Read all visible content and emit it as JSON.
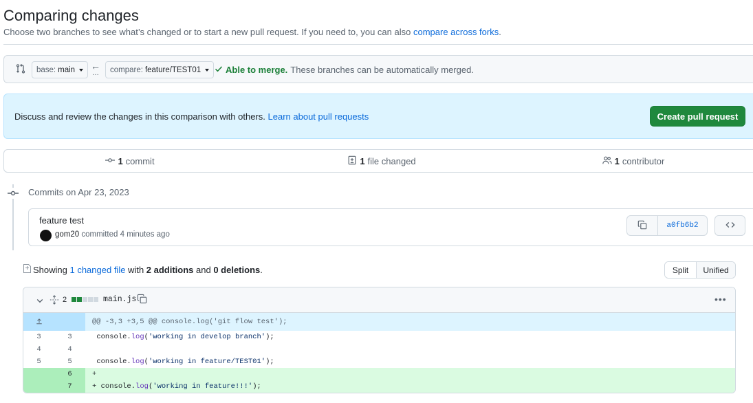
{
  "header": {
    "title": "Comparing changes",
    "subtitle_prefix": "Choose two branches to see what’s changed or to start a new pull request. If you need to, you can also ",
    "subtitle_link": "compare across forks",
    "subtitle_suffix": "."
  },
  "range": {
    "base_prefix": "base:",
    "base_value": "main",
    "compare_prefix": "compare:",
    "compare_value": "feature/TEST01",
    "merge_status": "Able to merge.",
    "merge_message": "These branches can be automatically merged."
  },
  "flash": {
    "text": "Discuss and review the changes in this comparison with others.",
    "link": "Learn about pull requests",
    "button": "Create pull request"
  },
  "summary": {
    "commits_count": "1",
    "commits_label": "commit",
    "files_count": "1",
    "files_label": "file changed",
    "contributors_count": "1",
    "contributors_label": "contributor"
  },
  "commits": {
    "date_heading": "Commits on Apr 23, 2023",
    "items": [
      {
        "title": "feature test",
        "author": "gom20",
        "meta": "committed 4 minutes ago",
        "sha": "a0fb6b2"
      }
    ]
  },
  "toc": {
    "prefix": "Showing ",
    "files_link": "1 changed file",
    "mid1": " with ",
    "additions": "2 additions",
    "mid2": " and ",
    "deletions": "0 deletions",
    "suffix": ".",
    "view_split": "Split",
    "view_unified": "Unified"
  },
  "file": {
    "changes_count": "2",
    "name": "main.js",
    "diffstat": [
      "add",
      "add",
      "neutral",
      "neutral",
      "neutral"
    ],
    "hunk_header": "@@ -3,3 +3,5 @@ console.log('git flow test');",
    "lines": [
      {
        "old": "3",
        "new": "3",
        "type": "context",
        "marker": " ",
        "obj": "console.",
        "fn": "log",
        "open": "(",
        "str": "'working in develop branch'",
        "close": ");"
      },
      {
        "old": "4",
        "new": "4",
        "type": "context",
        "marker": " ",
        "obj": "",
        "fn": "",
        "open": "",
        "str": "",
        "close": ""
      },
      {
        "old": "5",
        "new": "5",
        "type": "context",
        "marker": " ",
        "obj": "console.",
        "fn": "log",
        "open": "(",
        "str": "'working in feature/TEST01'",
        "close": ");"
      },
      {
        "old": "",
        "new": "6",
        "type": "add",
        "marker": "+",
        "obj": "",
        "fn": "",
        "open": "",
        "str": "",
        "close": ""
      },
      {
        "old": "",
        "new": "7",
        "type": "add",
        "marker": "+",
        "obj": "console.",
        "fn": "log",
        "open": "(",
        "str": "'working in feature!!!'",
        "close": ");"
      }
    ]
  },
  "colors": {
    "accent": "#0969da",
    "success": "#1f883d",
    "flash_bg": "#ddf4ff",
    "add_bg": "#dafbe1"
  },
  "icons": [
    "git-compare-icon",
    "arrow-left-icon",
    "check-icon",
    "git-commit-icon",
    "file-diff-icon",
    "people-icon",
    "copy-icon",
    "code-icon",
    "chevron-down-icon",
    "unfold-icon",
    "kebab-horizontal-icon",
    "file-icon"
  ]
}
